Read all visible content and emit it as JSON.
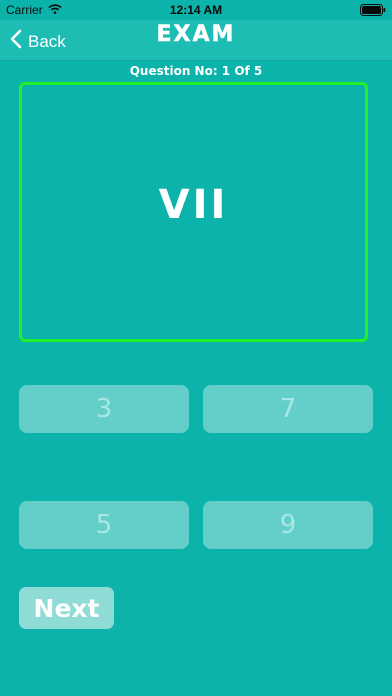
{
  "status_bar": {
    "carrier": "Carrier",
    "time": "12:14 AM"
  },
  "nav": {
    "back_label": "Back",
    "title": "EXAM"
  },
  "question": {
    "counter": "Question No: 1 Of 5",
    "text": "VII"
  },
  "options": [
    "3",
    "7",
    "5",
    "9"
  ],
  "next_label": "Next",
  "colors": {
    "background": "#0bb3aa",
    "card_border": "#22f02a",
    "option_bg": "#63cfc8",
    "next_bg": "#8fdcd6"
  }
}
